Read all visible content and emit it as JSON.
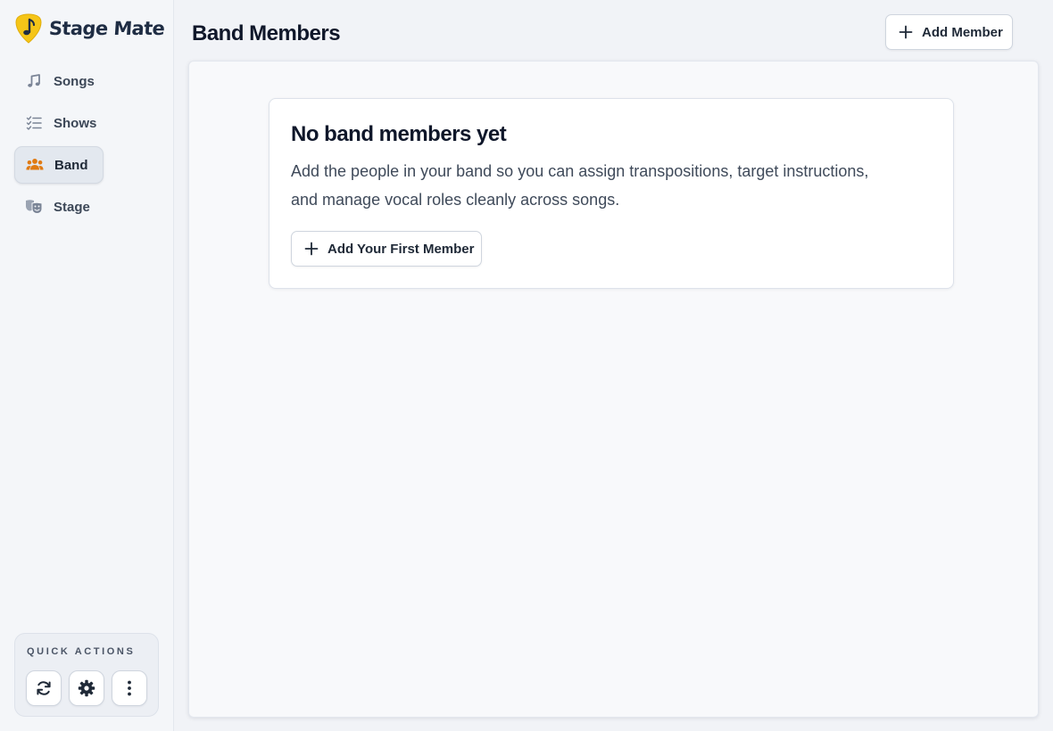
{
  "app": {
    "name": "Stage Mate",
    "accent": "#e07a12",
    "logo_color": "#f5c518"
  },
  "sidebar": {
    "items": [
      {
        "label": "Songs",
        "icon": "music-note-icon",
        "active": false
      },
      {
        "label": "Shows",
        "icon": "checklist-icon",
        "active": false
      },
      {
        "label": "Band",
        "icon": "users-icon",
        "active": true
      },
      {
        "label": "Stage",
        "icon": "theater-masks-icon",
        "active": false
      }
    ],
    "quick_actions": {
      "title": "QUICK ACTIONS",
      "buttons": [
        "refresh-icon",
        "gear-icon",
        "more-vertical-icon"
      ]
    }
  },
  "header": {
    "title": "Band Members",
    "add_button": "Add Member"
  },
  "empty_state": {
    "title": "No band members yet",
    "description": "Add the people in your band so you can assign transpositions, target instructions, and manage vocal roles cleanly across songs.",
    "button": "Add Your First Member"
  }
}
